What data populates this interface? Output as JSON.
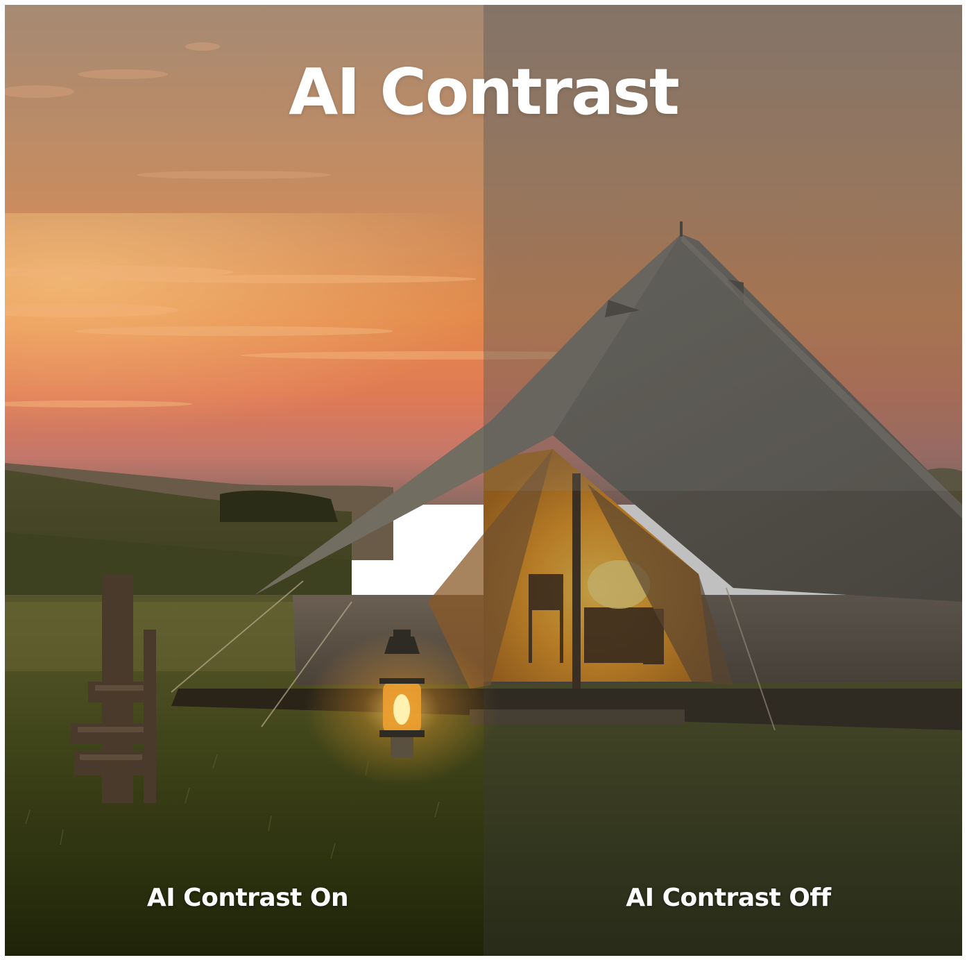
{
  "title": "AI Contrast",
  "labels": {
    "on": "AI Contrast On",
    "off": "AI Contrast Off"
  },
  "colors": {
    "sky_top": "#b08a6e",
    "sky_horizon": "#e58a45",
    "grass": "#3d4218",
    "tent_canvas": "#6e6a5e",
    "tent_glow": "#f0a21e",
    "text": "#ffffff",
    "off_overlay": "#3a3a3a"
  }
}
